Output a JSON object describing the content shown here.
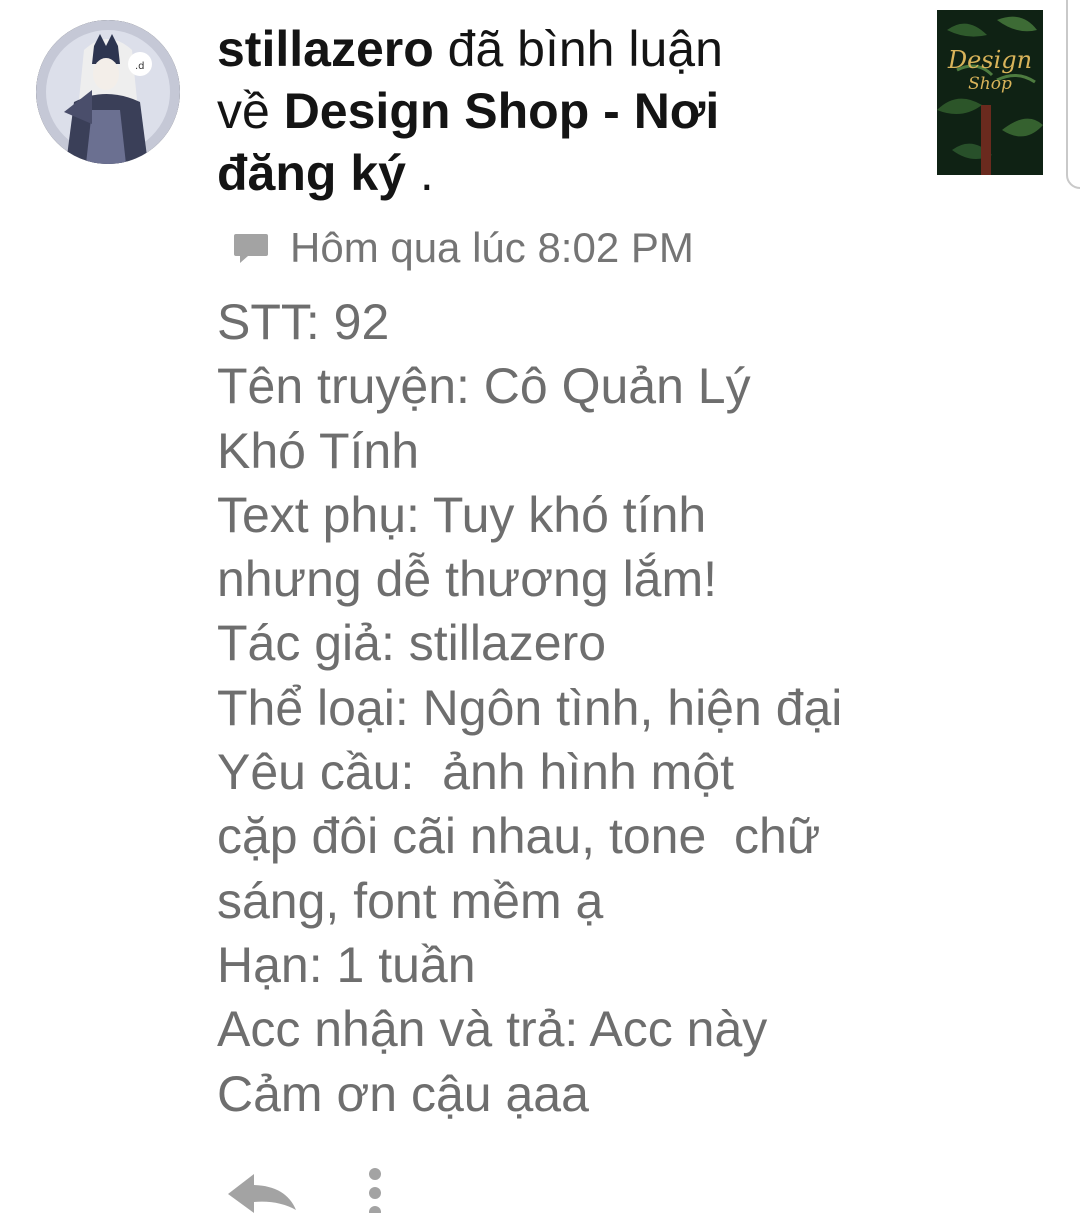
{
  "notification": {
    "actor": "stillazero",
    "verb": " đã bình luận",
    "preposition": "về ",
    "target_part1": "Design Shop - Nơi",
    "target_part2": "đăng ký",
    "suffix": " .",
    "thumbnail": {
      "title_line1": "Design",
      "title_line2": "Shop"
    },
    "timestamp": "Hôm qua lúc 8:02 PM",
    "comment_lines": [
      "STT: 92",
      "Tên truyện: Cô Quản Lý",
      "Khó Tính",
      "Text phụ: Tuy khó tính",
      "nhưng dễ thương lắm!",
      "Tác giả: stillazero",
      "Thể loại: Ngôn tình, hiện đại",
      "Yêu cầu:  ảnh hình một",
      "cặp đôi cãi nhau, tone  chữ",
      "sáng, font mềm ạ",
      "Hạn: 1 tuần",
      "Acc nhận và trả: Acc này",
      "Cảm ơn cậu ạaa"
    ]
  },
  "icons": {
    "avatar": "avatar-image",
    "comment": "comment-bubble-icon",
    "reply": "reply-arrow-icon",
    "more": "more-vertical-icon"
  },
  "colors": {
    "headline": "#141414",
    "timestamp": "#757575",
    "body": "#6e6e6e",
    "icon": "#a3a3a3",
    "thumb_text": "#d9b45a"
  }
}
